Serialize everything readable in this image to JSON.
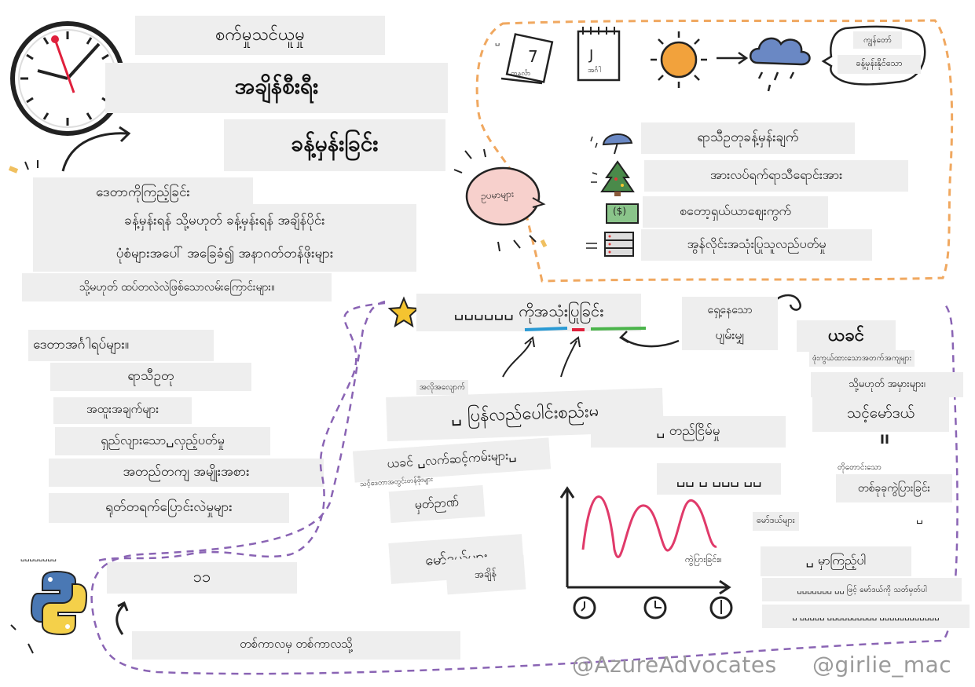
{
  "title": {
    "line1": "စက်မှုသင်ယူမှု",
    "line2": "အချိန်စီးရီး",
    "line3": "ခန့်မှန်းခြင်း"
  },
  "definition": {
    "line1": "ဒေတာကိုကြည့်ခြင်း",
    "line2": "ခန့်မှန်းရန် သို့မဟုတ် ခန့်မှန်းရန် အချိန်ပိုင်း",
    "line3": "ပုံစံများအပေါ် အခြေခံ၍ အနာဂတ်တန်ဖိုးများ",
    "line4": "သို့မဟုတ် ထပ်တလဲလဲဖြစ်သောလမ်းကြောင်းများ။"
  },
  "characteristics": {
    "heading": "ဒေတာအင်္ဂါရပ်များ။",
    "items": [
      "ရာသီဥတု",
      "အထူးအချက်များ",
      "ရှည်လျားသော␣လှည့်ပတ်မှု",
      "အတည်တကျ အမျိုးအစား",
      "ရုတ်တရက်ပြောင်းလဲမှုများ"
    ]
  },
  "python": {
    "caption": "␣␣␣␣␣␣␣␣",
    "value": "၁၁",
    "bottom_caption": "တစ်ကာလမှ တစ်ကာလသို့"
  },
  "uses": {
    "calendar_label": "တနင်္လာ",
    "calendar_day": "7",
    "calendar2_label": "အင်္ဂါ",
    "calendar2_day": "J",
    "bubble_text1": "ကျွန်တော်",
    "bubble_text2": "ခန့်မှန်းနိုင်သော",
    "examples_bubble": "ဥပမာများ",
    "corner_glyph": "␣",
    "items": [
      "ရာသီဥတုခန့်မှန်းချက်",
      "အားလပ်ရက်ရာသီရောင်းအား",
      "စတော့ရှယ်ယာဈေးကွက်",
      "အွန်လိုင်းအသုံးပြုသူလည်ပတ်မှု"
    ],
    "dollar_symbol": "($)"
  },
  "using": {
    "star_title": "␣␣␣␣␣␣ ကိုအသုံးပြုခြင်း",
    "missing1": "ရှေ့နေသော",
    "missing2": "ပျမ်းမျှ",
    "small_note": "အလိုအလျောက်",
    "regression": "␣ ပြန်လည်ပေါင်းစည်းမှု",
    "stationarity": "␣ တည်ငြိမ်မှု",
    "features_label": "ယခင် ␣လက်ဆင့်ကမ်းများ␣",
    "features_sub": "သင့်ဒေတာအတွင်းတန်ဖိုးများ",
    "lag_label": "မှတ်ဉာဏ်",
    "models_label": "မော်ဒယ်များ",
    "time_label": "အချိန်"
  },
  "chart": {
    "title": "␣␣ ␣ ␣␣␣ ␣␣",
    "caption": "ကွဲပြားခြင်း။"
  },
  "right": {
    "heading": "ယခင်",
    "sub1": "ဖုံးကွယ်ထားသောအတက်အကျများ",
    "sub2": "သို့မဟုတ် အမှားများ၊",
    "your_model": "သင့်မော်ဒယ်",
    "divider_glyph": "II",
    "short_note": "တိုတောင်းသော",
    "change": "တစ်ခုခုကွဲပြားခြင်း",
    "change_glyph": "␣",
    "models_note": "မော်ဒယ်များ",
    "look": "␣ မှာကြည့်ပါ",
    "eval1": "␣␣␣␣␣␣␣ ␣␣ ဖြင့် မော်ဒယ်ကို သတ်မှတ်ပါ",
    "eval2": "␣ ␣␣␣␣␣ ␣␣␣␣␣␣␣␣␣␣ ␣␣␣␣␣␣␣␣␣␣␣␣"
  },
  "footer": {
    "left": "@AzureAdvocates",
    "right": "@girlie_mac"
  },
  "colors": {
    "accent_orange": "#f0a860",
    "accent_purple": "#8a64b4",
    "clock_red": "#e0203c",
    "chart_pink": "#e03a6a",
    "star_yellow": "#f4c430",
    "python_blue": "#4a78b4",
    "python_yellow": "#f4d04a"
  }
}
